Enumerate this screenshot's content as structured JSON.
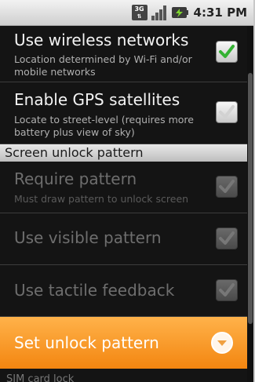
{
  "status_bar": {
    "network_type": "3G",
    "signal_icon": "signal-bars-icon",
    "battery_icon": "battery-charging-icon",
    "time": "4:31 PM"
  },
  "settings": {
    "wireless": {
      "title": "Use wireless networks",
      "summary": "Location determined by Wi-Fi and/or mobile networks",
      "checked": true,
      "enabled": true
    },
    "gps": {
      "title": "Enable GPS satellites",
      "summary": "Locate to street-level (requires more battery plus view of sky)",
      "checked": false,
      "enabled": true
    },
    "section_header": "Screen unlock pattern",
    "require_pattern": {
      "title": "Require pattern",
      "summary": "Must draw pattern to unlock screen",
      "checked": false,
      "enabled": false
    },
    "visible_pattern": {
      "title": "Use visible pattern",
      "checked": false,
      "enabled": false
    },
    "tactile_feedback": {
      "title": "Use tactile feedback",
      "checked": false,
      "enabled": false
    },
    "set_unlock_pattern": {
      "title": "Set unlock pattern",
      "highlighted": true
    }
  },
  "next_item_peek": "SIM card lock",
  "colors": {
    "highlight": "#f59a24",
    "check_green": "#34b233",
    "section_bg": "#d9d9d9"
  }
}
